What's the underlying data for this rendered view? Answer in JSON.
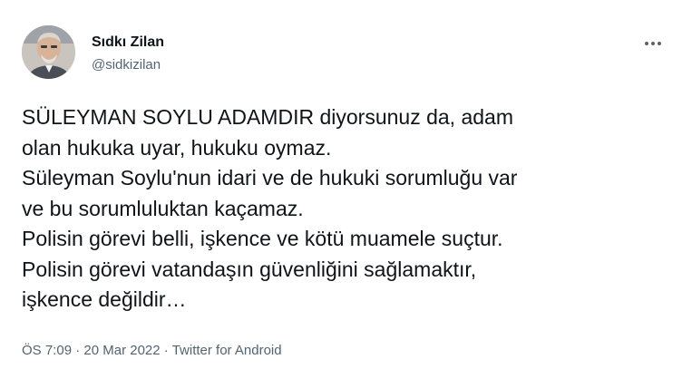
{
  "author": {
    "name": "Sıdkı Zilan",
    "handle": "@sidkizilan"
  },
  "more_menu": {
    "icon": "more-horizontal-icon"
  },
  "tweet": {
    "lines": [
      "SÜLEYMAN SOYLU ADAMDIR diyorsunuz da, adam",
      "olan hukuka uyar, hukuku oymaz.",
      "Süleyman Soylu'nun idari ve de hukuki sorumluğu var",
      "ve bu sorumluluktan kaçamaz.",
      "Polisin görevi belli, işkence ve kötü muamele suçtur.",
      "Polisin görevi vatandaşın güvenliğini sağlamaktır,",
      "işkence değildir…"
    ]
  },
  "meta": {
    "time": "ÖS 7:09",
    "separator": "·",
    "date": "20 Mar 2022",
    "source": "Twitter for Android"
  },
  "colors": {
    "text": "#0f1419",
    "secondary": "#536471",
    "background": "#ffffff"
  }
}
